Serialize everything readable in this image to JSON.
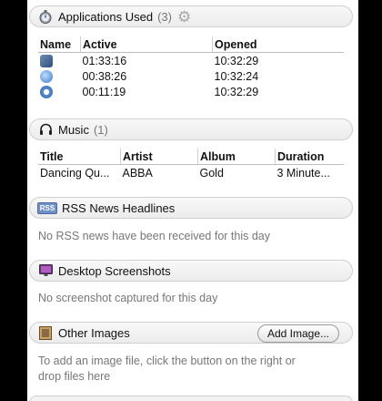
{
  "apps": {
    "title": "Applications Used",
    "count": "(3)",
    "headers": [
      "Name",
      "Active",
      "Opened"
    ],
    "rows": [
      {
        "icon": "utility-app-icon",
        "active": "01:33:16",
        "opened": "10:32:29"
      },
      {
        "icon": "network-app-icon",
        "active": "00:38:26",
        "opened": "10:32:24"
      },
      {
        "icon": "itunes-app-icon",
        "active": "00:11:19",
        "opened": "10:32:29"
      }
    ]
  },
  "music": {
    "title": "Music",
    "count": "(1)",
    "headers": [
      "Title",
      "Artist",
      "Album",
      "Duration"
    ],
    "rows": [
      {
        "title": "Dancing Qu...",
        "artist": "ABBA",
        "album": "Gold",
        "duration": "3 Minute..."
      }
    ]
  },
  "rss": {
    "badge": "RSS",
    "title": "RSS News Headlines",
    "empty": "No RSS news have been received for this day"
  },
  "screens": {
    "title": "Desktop Screenshots",
    "empty": "No screenshot captured for this day"
  },
  "images": {
    "title": "Other Images",
    "button": "Add Image...",
    "empty_line1": "To add an image file, click the button on the right or",
    "empty_line2": "drop files here"
  }
}
